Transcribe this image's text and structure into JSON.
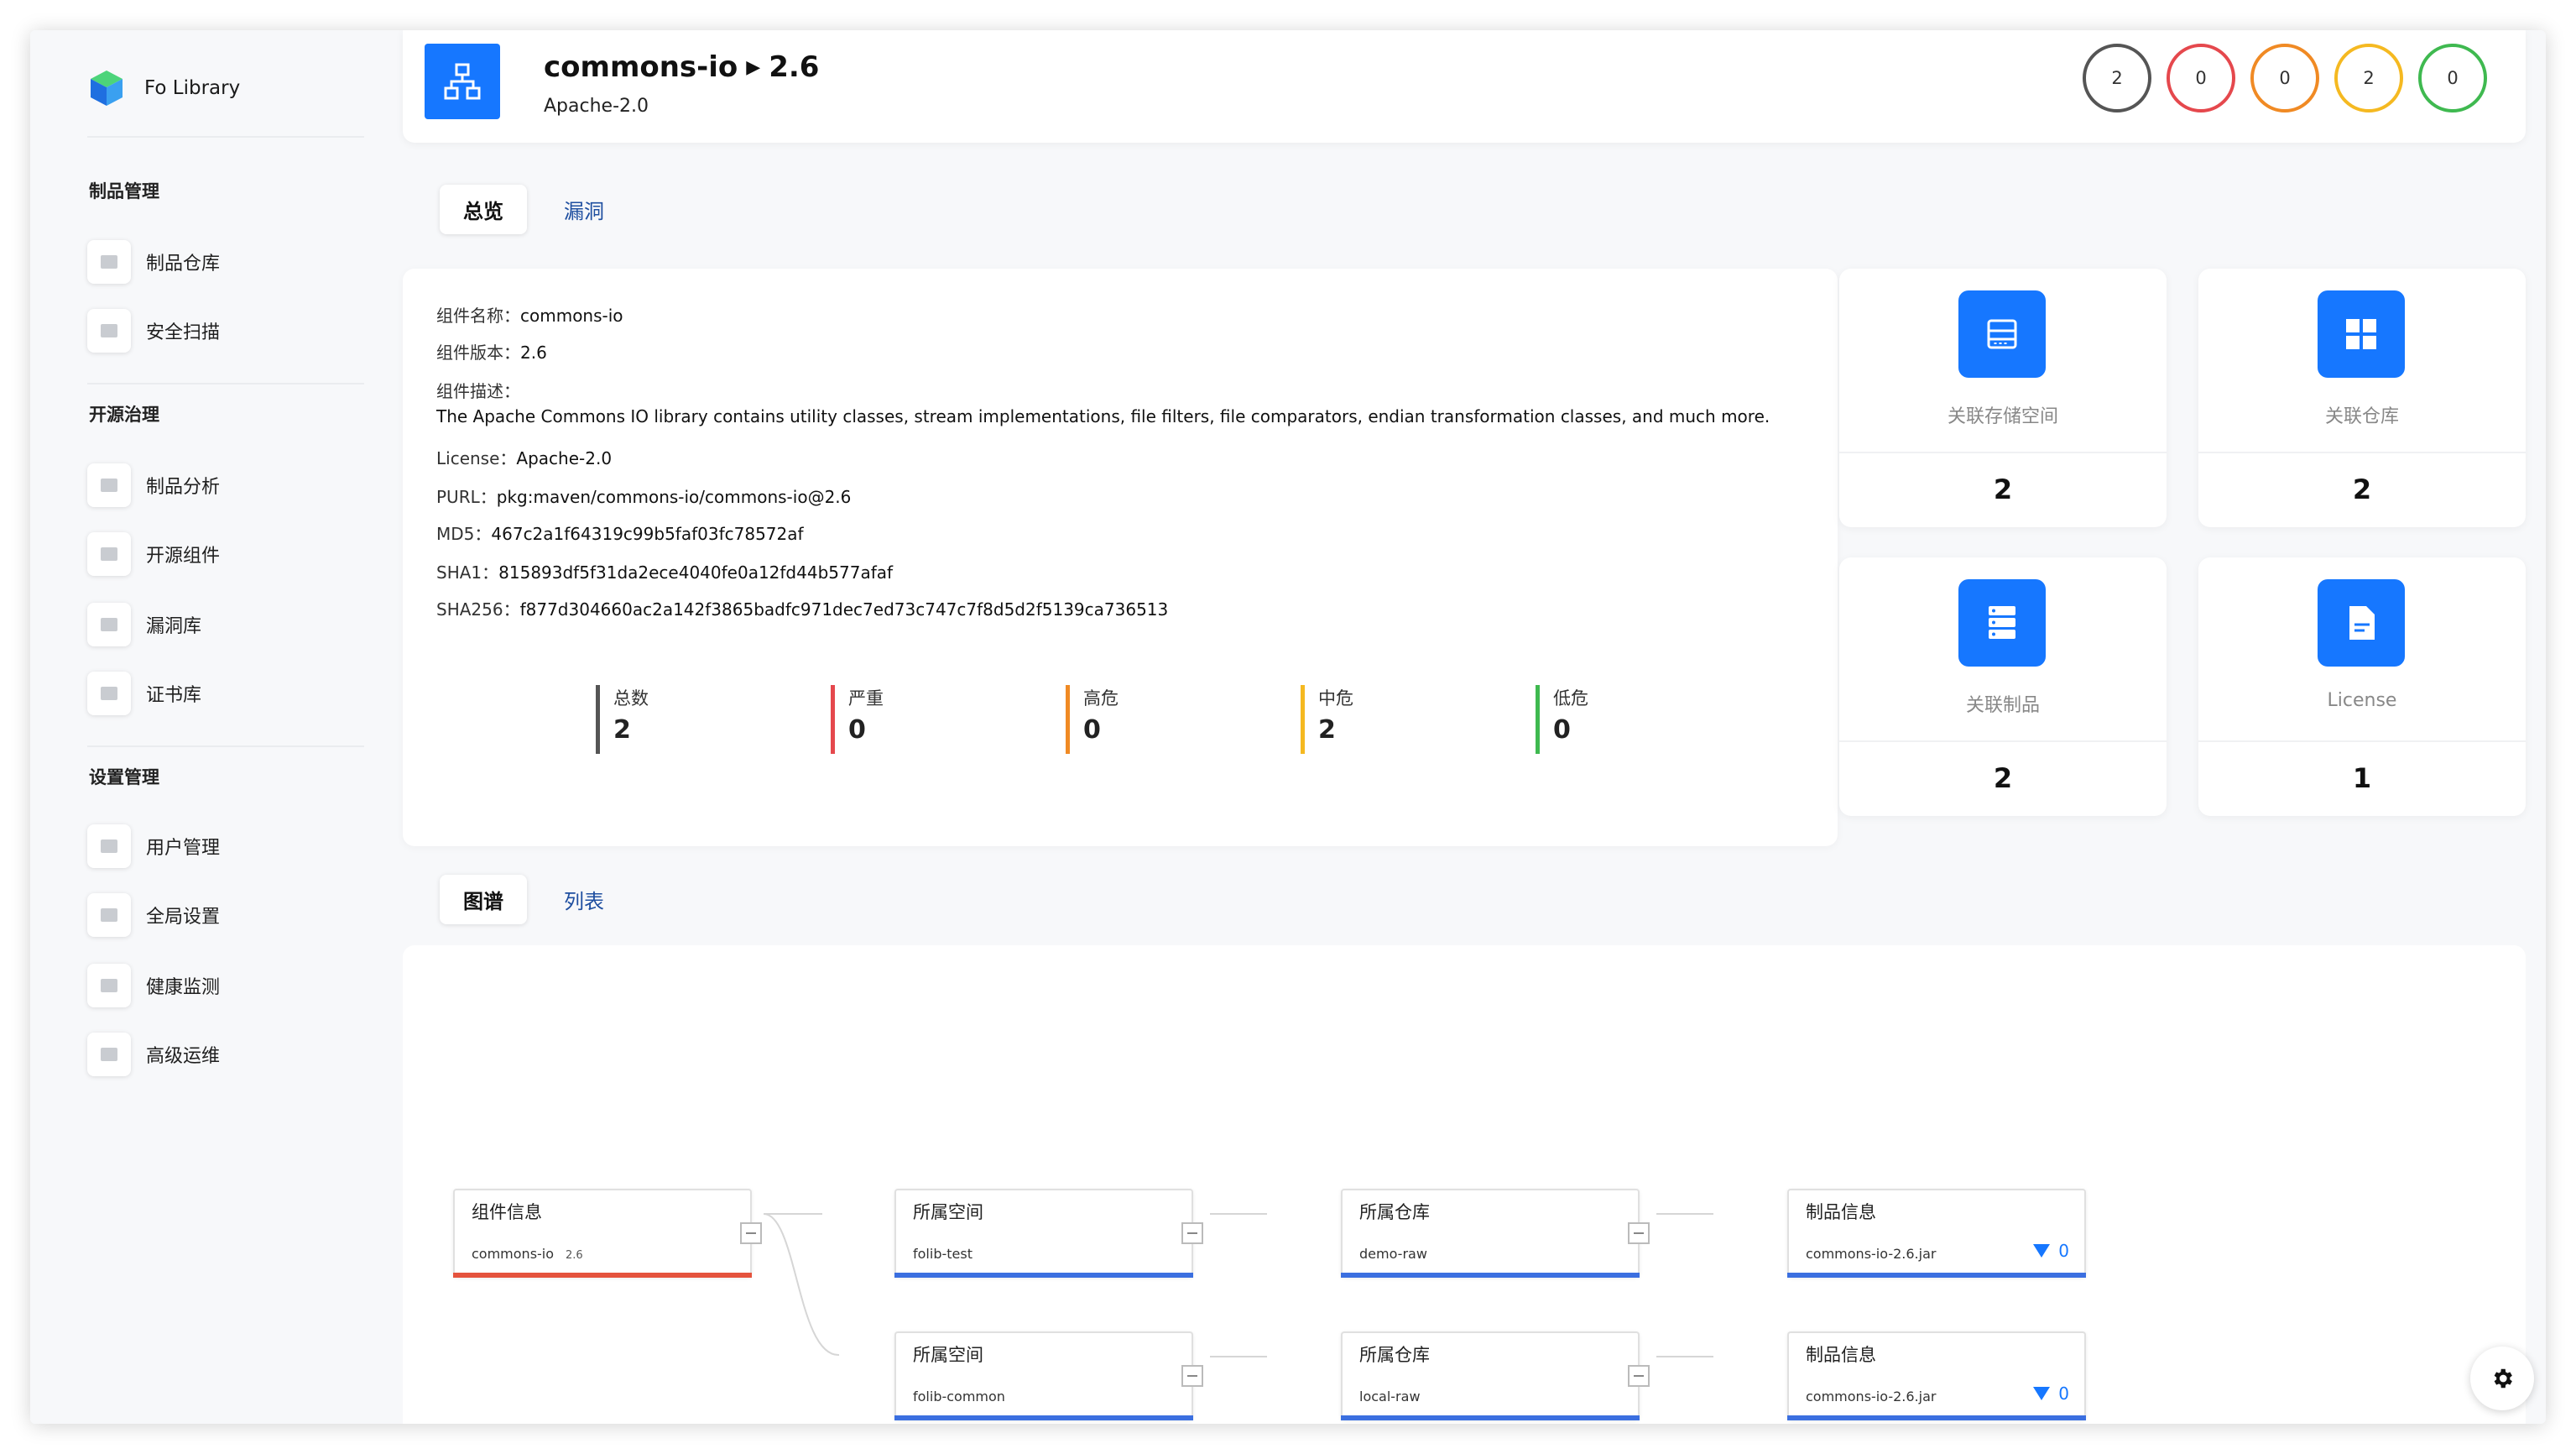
{
  "brand": {
    "name": "Fo Library"
  },
  "sidebar": {
    "sections": [
      {
        "title": "制品管理",
        "items": [
          {
            "label": "制品仓库",
            "icon": "grid-icon"
          },
          {
            "label": "安全扫描",
            "icon": "card-icon"
          }
        ]
      },
      {
        "title": "开源治理",
        "items": [
          {
            "label": "制品分析",
            "icon": "document-icon"
          },
          {
            "label": "开源组件",
            "icon": "list-icon"
          },
          {
            "label": "漏洞库",
            "icon": "bug-icon"
          },
          {
            "label": "证书库",
            "icon": "certificate-icon"
          }
        ]
      },
      {
        "title": "设置管理",
        "items": [
          {
            "label": "用户管理",
            "icon": "user-icon"
          },
          {
            "label": "全局设置",
            "icon": "wrench-icon"
          },
          {
            "label": "健康监测",
            "icon": "chart-icon"
          },
          {
            "label": "高级运维",
            "icon": "tools-icon"
          }
        ]
      }
    ]
  },
  "header": {
    "name": "commons-io",
    "version": "2.6",
    "license": "Apache-2.0",
    "severity_counts": [
      {
        "value": "2",
        "color": "#555555"
      },
      {
        "value": "0",
        "color": "#e5484d"
      },
      {
        "value": "0",
        "color": "#f08a24"
      },
      {
        "value": "2",
        "color": "#f5b921"
      },
      {
        "value": "0",
        "color": "#3fb950"
      }
    ]
  },
  "tabs_top": {
    "overview": "总览",
    "vulns": "漏洞"
  },
  "info": {
    "name_label": "组件名称：",
    "name": "commons-io",
    "version_label": "组件版本：",
    "version": "2.6",
    "desc_label": "组件描述：",
    "desc": "The Apache Commons IO library contains utility classes, stream implementations, file filters, file comparators, endian transformation classes, and much more.",
    "license_label": "License：",
    "license": "Apache-2.0",
    "purl_label": "PURL：",
    "purl": "pkg:maven/commons-io/commons-io@2.6",
    "md5_label": "MD5：",
    "md5": "467c2a1f64319c99b5faf03fc78572af",
    "sha1_label": "SHA1：",
    "sha1": "815893df5f31da2ece4040fe0a12fd44b577afaf",
    "sha256_label": "SHA256：",
    "sha256": "f877d304660ac2a142f3865badfc971dec7ed73c747c7f8d5d2f5139ca736513"
  },
  "stats": [
    {
      "label": "总数",
      "value": "2",
      "color": "#555555"
    },
    {
      "label": "严重",
      "value": "0",
      "color": "#e5484d"
    },
    {
      "label": "高危",
      "value": "0",
      "color": "#f08a24"
    },
    {
      "label": "中危",
      "value": "2",
      "color": "#f5b921"
    },
    {
      "label": "低危",
      "value": "0",
      "color": "#3fb950"
    }
  ],
  "side_cards": [
    {
      "caption": "关联存储空间",
      "value": "2",
      "icon": "storage-icon"
    },
    {
      "caption": "关联仓库",
      "value": "2",
      "icon": "windows-grid-icon"
    },
    {
      "caption": "关联制品",
      "value": "2",
      "icon": "server-icon"
    },
    {
      "caption": "License",
      "value": "1",
      "icon": "file-icon"
    }
  ],
  "tabs_bottom": {
    "graph": "图谱",
    "list": "列表"
  },
  "graph": {
    "root": {
      "title": "组件信息",
      "name": "commons-io",
      "version": "2.6"
    },
    "rows": [
      {
        "space_title": "所属空间",
        "space": "folib-test",
        "repo_title": "所属仓库",
        "repo": "demo-raw",
        "artifact_title": "制品信息",
        "artifact": "commons-io-2.6.jar",
        "vuln_count": "0"
      },
      {
        "space_title": "所属空间",
        "space": "folib-common",
        "repo_title": "所属仓库",
        "repo": "local-raw",
        "artifact_title": "制品信息",
        "artifact": "commons-io-2.6.jar",
        "vuln_count": "0"
      }
    ],
    "accent": "#3b6fe0",
    "root_accent": "#e5533d"
  }
}
